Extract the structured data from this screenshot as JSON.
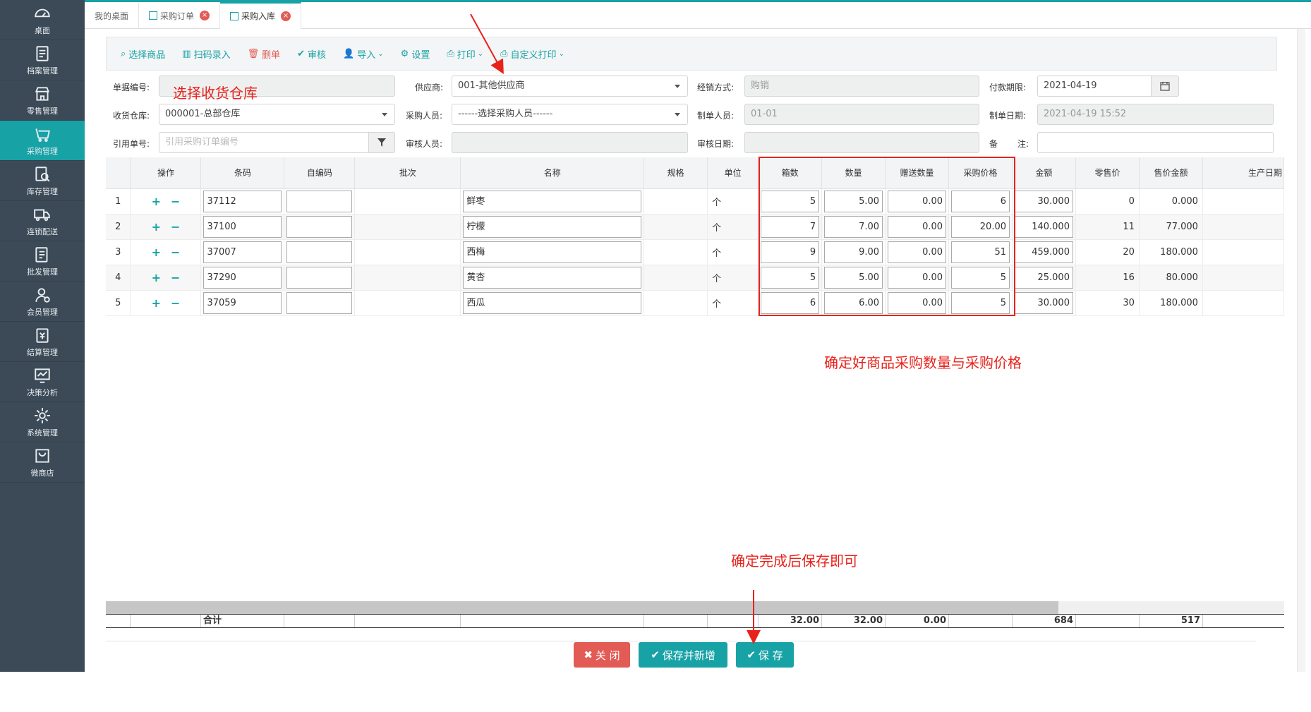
{
  "sidebar": {
    "items": [
      {
        "label": "桌面",
        "icon": "dashboard-icon"
      },
      {
        "label": "档案管理",
        "icon": "archive-icon"
      },
      {
        "label": "零售管理",
        "icon": "store-icon"
      },
      {
        "label": "采购管理",
        "icon": "purchase-icon"
      },
      {
        "label": "库存管理",
        "icon": "inventory-icon"
      },
      {
        "label": "连锁配送",
        "icon": "truck-icon"
      },
      {
        "label": "批发管理",
        "icon": "wholesale-icon"
      },
      {
        "label": "会员管理",
        "icon": "member-icon"
      },
      {
        "label": "结算管理",
        "icon": "settlement-icon"
      },
      {
        "label": "决策分析",
        "icon": "analysis-icon"
      },
      {
        "label": "系统管理",
        "icon": "gear-icon"
      },
      {
        "label": "微商店",
        "icon": "shop-icon"
      }
    ]
  },
  "tabs": [
    {
      "label": "我的桌面"
    },
    {
      "label": "采购订单"
    },
    {
      "label": "采购入库"
    }
  ],
  "toolbar": {
    "select_goods": "选择商品",
    "scan_entry": "扫码录入",
    "delete": "删单",
    "audit": "审核",
    "import": "导入",
    "settings": "设置",
    "print": "打印",
    "custom_print": "自定义打印"
  },
  "form": {
    "doc_no_label": "单据编号:",
    "doc_no_value": "",
    "supplier_label": "供应商:",
    "supplier_value": "001-其他供应商",
    "sales_mode_label": "经销方式:",
    "sales_mode_value": "购销",
    "pay_term_label": "付款期限:",
    "pay_term_value": "2021-04-19",
    "warehouse_label": "收货仓库:",
    "warehouse_value": "000001-总部仓库",
    "buyer_label": "采购人员:",
    "buyer_value": "------选择采购人员------",
    "creator_label": "制单人员:",
    "creator_value": "01-01",
    "create_date_label": "制单日期:",
    "create_date_value": "2021-04-19 15:52",
    "ref_no_label": "引用单号:",
    "ref_no_placeholder": "引用采购订单编号",
    "auditor_label": "审核人员:",
    "audit_date_label": "审核日期:",
    "remark_label_1": "备",
    "remark_label_2": "注:"
  },
  "table": {
    "headers": [
      "操作",
      "条码",
      "自编码",
      "批次",
      "名称",
      "规格",
      "单位",
      "箱数",
      "数量",
      "赠送数量",
      "采购价格",
      "金额",
      "零售价",
      "售价金额",
      "生产日期"
    ],
    "rows": [
      {
        "idx": "1",
        "barcode": "37112",
        "code": "",
        "batch": "",
        "name": "鲜枣",
        "spec": "",
        "unit": "个",
        "boxes": "5",
        "qty": "5.00",
        "gift": "0.00",
        "price": "6",
        "amount": "30.000",
        "retail": "0",
        "retail_amount": "0.000"
      },
      {
        "idx": "2",
        "barcode": "37100",
        "code": "",
        "batch": "",
        "name": "柠檬",
        "spec": "",
        "unit": "个",
        "boxes": "7",
        "qty": "7.00",
        "gift": "0.00",
        "price": "20.00",
        "amount": "140.000",
        "retail": "11",
        "retail_amount": "77.000"
      },
      {
        "idx": "3",
        "barcode": "37007",
        "code": "",
        "batch": "",
        "name": "西梅",
        "spec": "",
        "unit": "个",
        "boxes": "9",
        "qty": "9.00",
        "gift": "0.00",
        "price": "51",
        "amount": "459.000",
        "retail": "20",
        "retail_amount": "180.000"
      },
      {
        "idx": "4",
        "barcode": "37290",
        "code": "",
        "batch": "",
        "name": "黄杏",
        "spec": "",
        "unit": "个",
        "boxes": "5",
        "qty": "5.00",
        "gift": "0.00",
        "price": "5",
        "amount": "25.000",
        "retail": "16",
        "retail_amount": "80.000"
      },
      {
        "idx": "5",
        "barcode": "37059",
        "code": "",
        "batch": "",
        "name": "西瓜",
        "spec": "",
        "unit": "个",
        "boxes": "6",
        "qty": "6.00",
        "gift": "0.00",
        "price": "5",
        "amount": "30.000",
        "retail": "30",
        "retail_amount": "180.000"
      }
    ],
    "totals": {
      "label": "合计",
      "boxes": "32.00",
      "qty": "32.00",
      "gift": "0.00",
      "amount": "684",
      "retail_amount": "517"
    }
  },
  "buttons": {
    "close": "关 闭",
    "save_new": "保存并新增",
    "save": "保 存"
  },
  "annotations": {
    "select_warehouse": "选择收货仓库",
    "confirm_qty_price": "确定好商品采购数量与采购价格",
    "save_after": "确定完成后保存即可"
  },
  "colors": {
    "accent": "#17a2a6",
    "sidebar_bg": "#3c4a57",
    "annotation": "#e8221b",
    "close_btn": "#e25b55"
  }
}
